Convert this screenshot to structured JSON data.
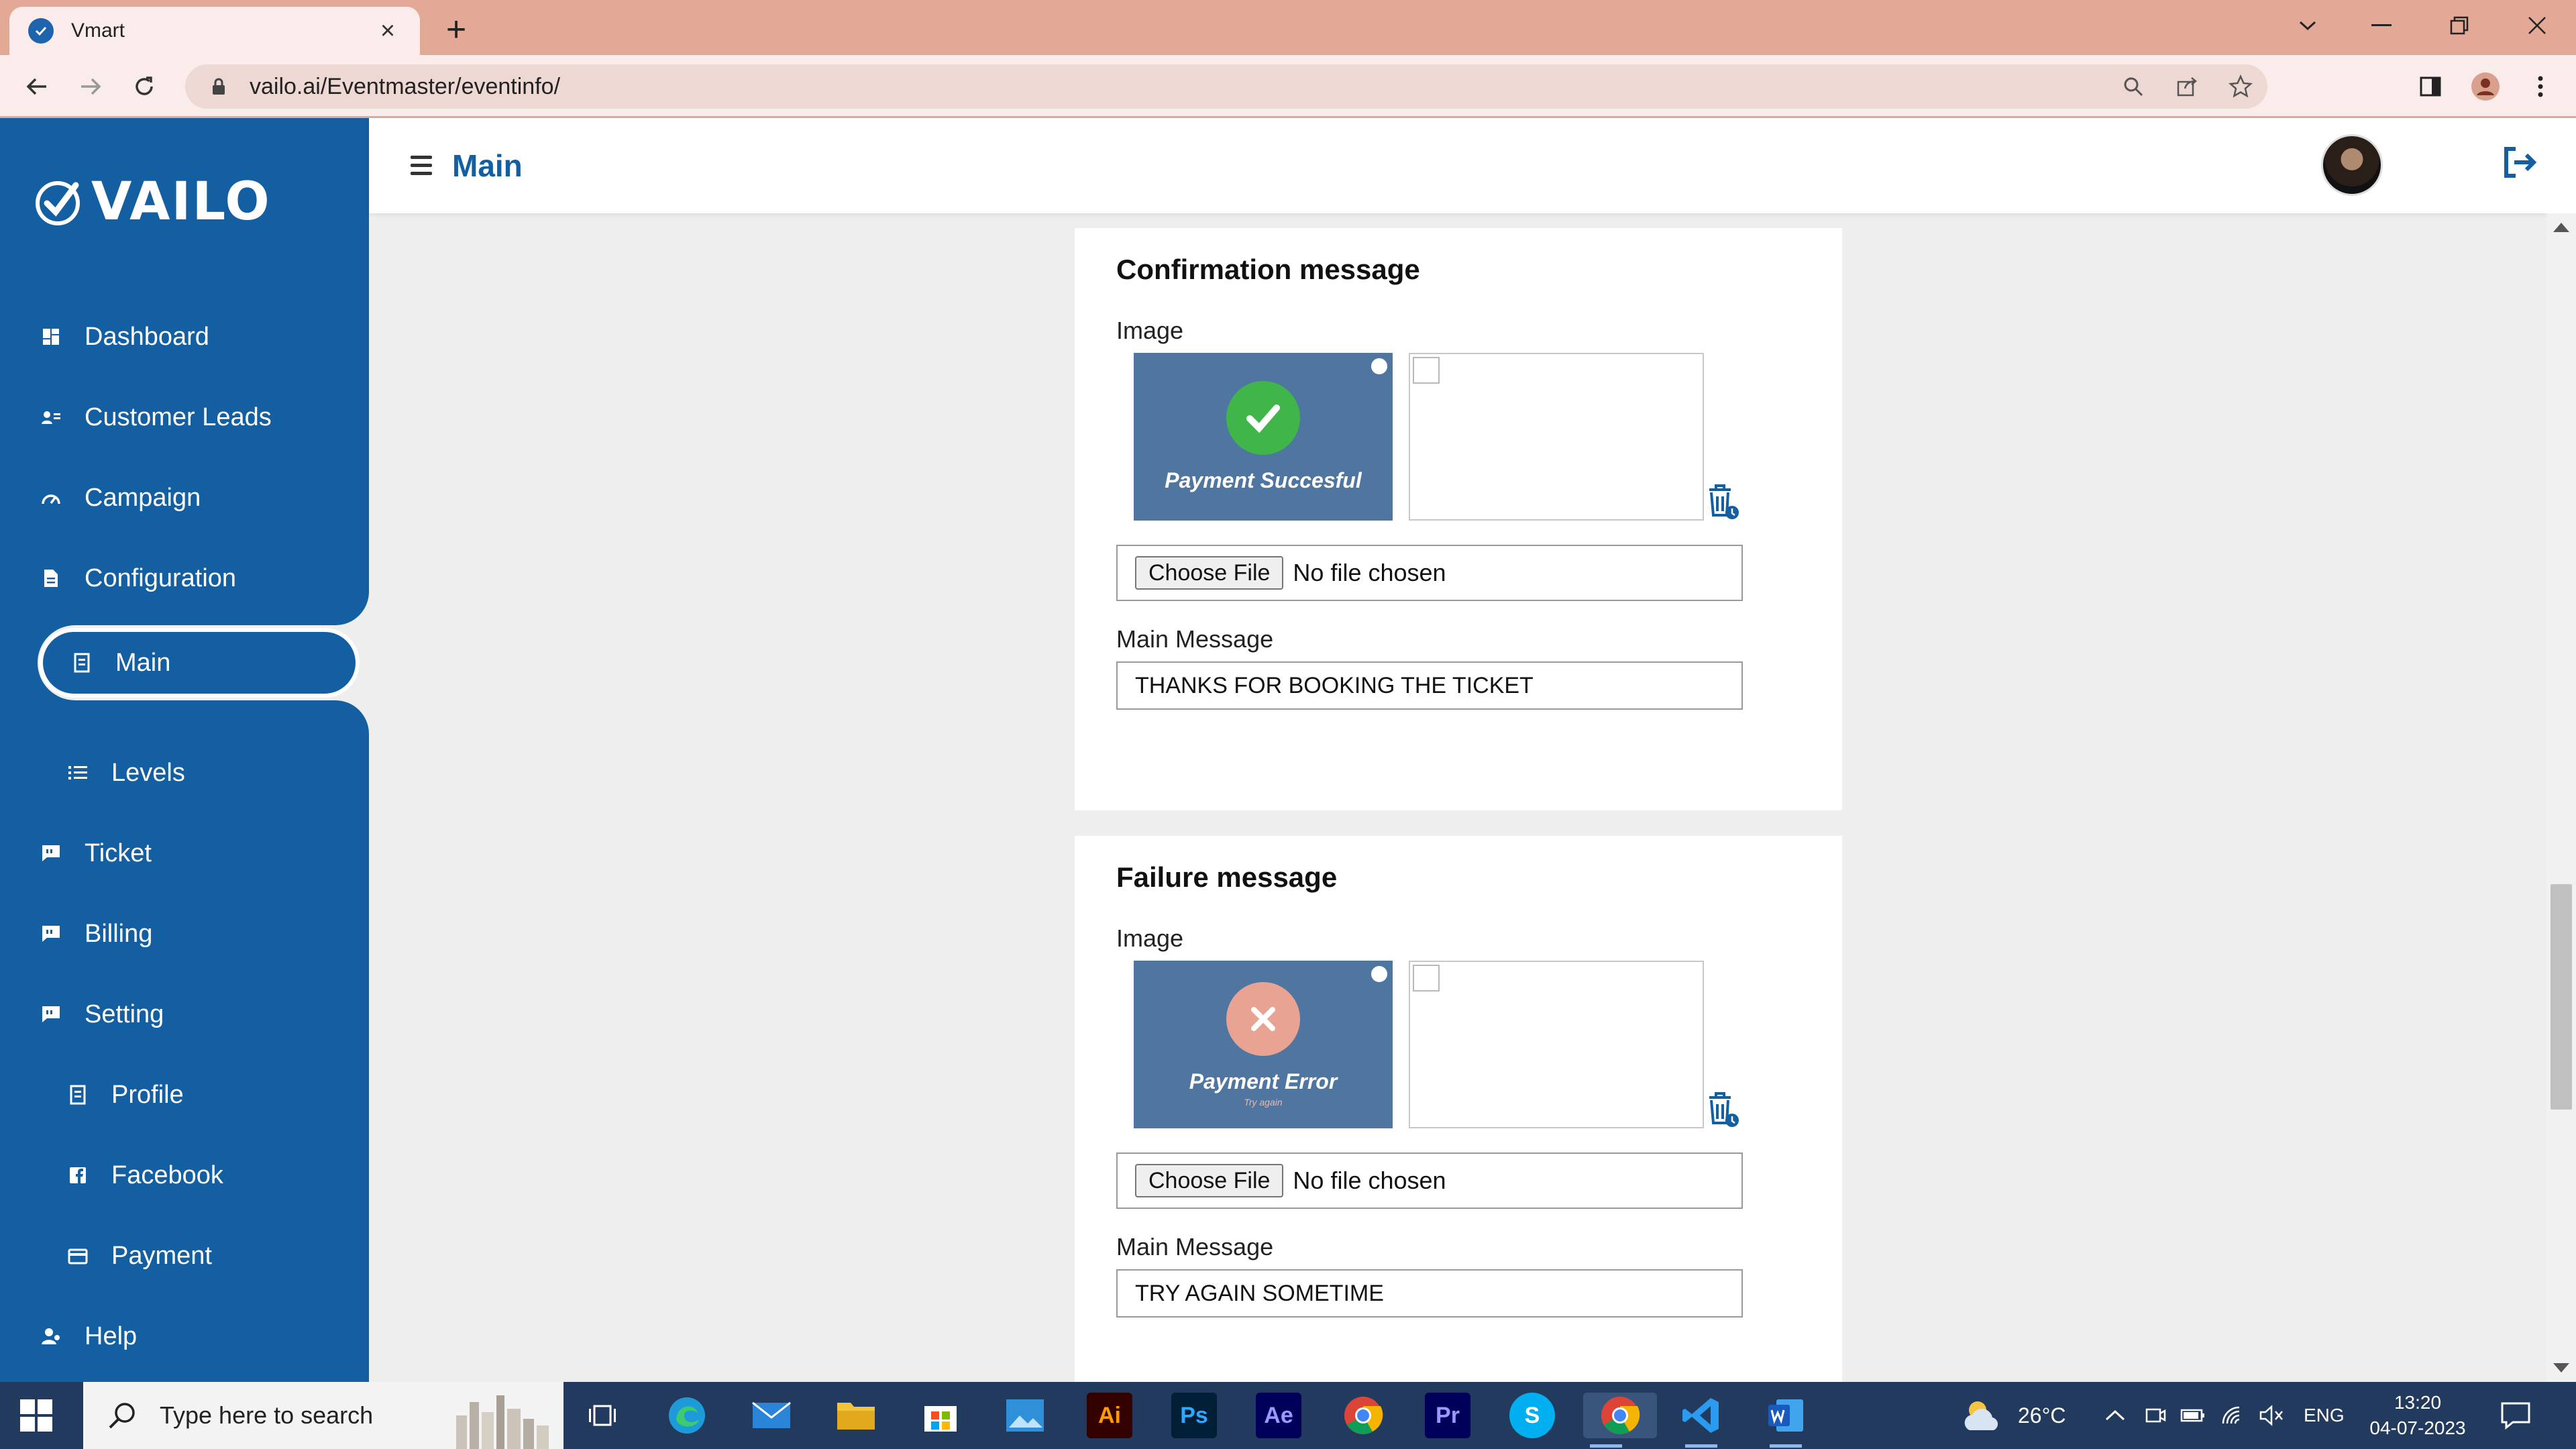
{
  "browser": {
    "tab_title": "Vmart",
    "new_tab": "+",
    "url": "vailo.ai/Eventmaster/eventinfo/"
  },
  "sidebar": {
    "brand": "VAILO",
    "items": [
      {
        "label": "Dashboard",
        "icon": "dashboard-icon"
      },
      {
        "label": "Customer Leads",
        "icon": "contacts-icon"
      },
      {
        "label": "Campaign",
        "icon": "speedometer-icon"
      },
      {
        "label": "Configuration",
        "icon": "document-icon"
      },
      {
        "label": "Main",
        "icon": "page-icon",
        "active": true
      },
      {
        "label": "Levels",
        "icon": "list-icon"
      },
      {
        "label": "Ticket",
        "icon": "chat-icon"
      },
      {
        "label": "Billing",
        "icon": "chat-icon"
      },
      {
        "label": "Setting",
        "icon": "chat-icon"
      },
      {
        "label": "Profile",
        "icon": "page-icon"
      },
      {
        "label": "Facebook",
        "icon": "facebook-icon"
      },
      {
        "label": "Payment",
        "icon": "wallet-icon"
      },
      {
        "label": "Help",
        "icon": "person-icon"
      }
    ]
  },
  "header": {
    "title": "Main"
  },
  "confirmation": {
    "title": "Confirmation message",
    "image_label": "Image",
    "preview_text": "Payment Succesful",
    "file_button": "Choose File",
    "file_status": "No file chosen",
    "message_label": "Main Message",
    "message_value": "THANKS FOR BOOKING THE TICKET"
  },
  "failure": {
    "title": "Failure message",
    "image_label": "Image",
    "preview_text": "Payment Error",
    "preview_sub": "Try again",
    "file_button": "Choose File",
    "file_status": "No file chosen",
    "message_label": "Main Message",
    "message_value": "TRY AGAIN SOMETIME"
  },
  "taskbar": {
    "search_placeholder": "Type here to search",
    "weather": "26°C",
    "language": "ENG",
    "time": "13:20",
    "date": "04-07-2023",
    "apps": [
      "Ai",
      "Ps",
      "Ae",
      "Pr",
      "S"
    ]
  },
  "colors": {
    "sidebar": "#135fa2",
    "accent": "#135fa2",
    "success": "#3fb54a",
    "error": "#e8a393",
    "tab_bar": "#e4a896"
  }
}
